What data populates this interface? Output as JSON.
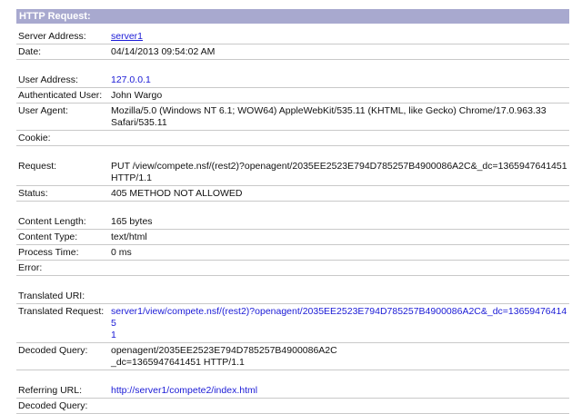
{
  "header": {
    "title": "HTTP Request:"
  },
  "rows": {
    "server_address": {
      "label": "Server Address:",
      "value": "server1"
    },
    "date": {
      "label": "Date:",
      "value": "04/14/2013 09:54:02 AM"
    },
    "user_address": {
      "label": "User Address:",
      "value": "127.0.0.1"
    },
    "authenticated_user": {
      "label": "Authenticated User:",
      "value": "John Wargo"
    },
    "user_agent": {
      "label": "User Agent:",
      "value": "Mozilla/5.0 (Windows NT 6.1; WOW64) AppleWebKit/535.11 (KHTML, like Gecko) Chrome/17.0.963.33\nSafari/535.11"
    },
    "cookie": {
      "label": "Cookie:",
      "value": ""
    },
    "request": {
      "label": "Request:",
      "value": "PUT /view/compete.nsf/(rest2)?openagent/2035EE2523E794D785257B4900086A2C&_dc=1365947641451\nHTTP/1.1"
    },
    "status": {
      "label": "Status:",
      "value": "405 METHOD NOT ALLOWED"
    },
    "content_length": {
      "label": "Content Length:",
      "value": "165 bytes"
    },
    "content_type": {
      "label": "Content Type:",
      "value": "text/html"
    },
    "process_time": {
      "label": "Process Time:",
      "value": "0 ms"
    },
    "error": {
      "label": "Error:",
      "value": ""
    },
    "translated_uri": {
      "label": "Translated URI:",
      "value": ""
    },
    "translated_request": {
      "label": "Translated Request:",
      "value": "server1/view/compete.nsf/(rest2)?openagent/2035EE2523E794D785257B4900086A2C&_dc=136594764145\n1"
    },
    "decoded_query": {
      "label": "Decoded Query:",
      "value": "openagent/2035EE2523E794D785257B4900086A2C\n_dc=1365947641451 HTTP/1.1"
    },
    "referring_url": {
      "label": "Referring URL:",
      "value": "http://server1/compete2/index.html"
    },
    "decoded_query_2": {
      "label": "Decoded Query:",
      "value": ""
    }
  },
  "colors": {
    "header_bg": "#a8a9cf",
    "link": "#1a1ad6",
    "row_border": "#c9c9c9"
  }
}
